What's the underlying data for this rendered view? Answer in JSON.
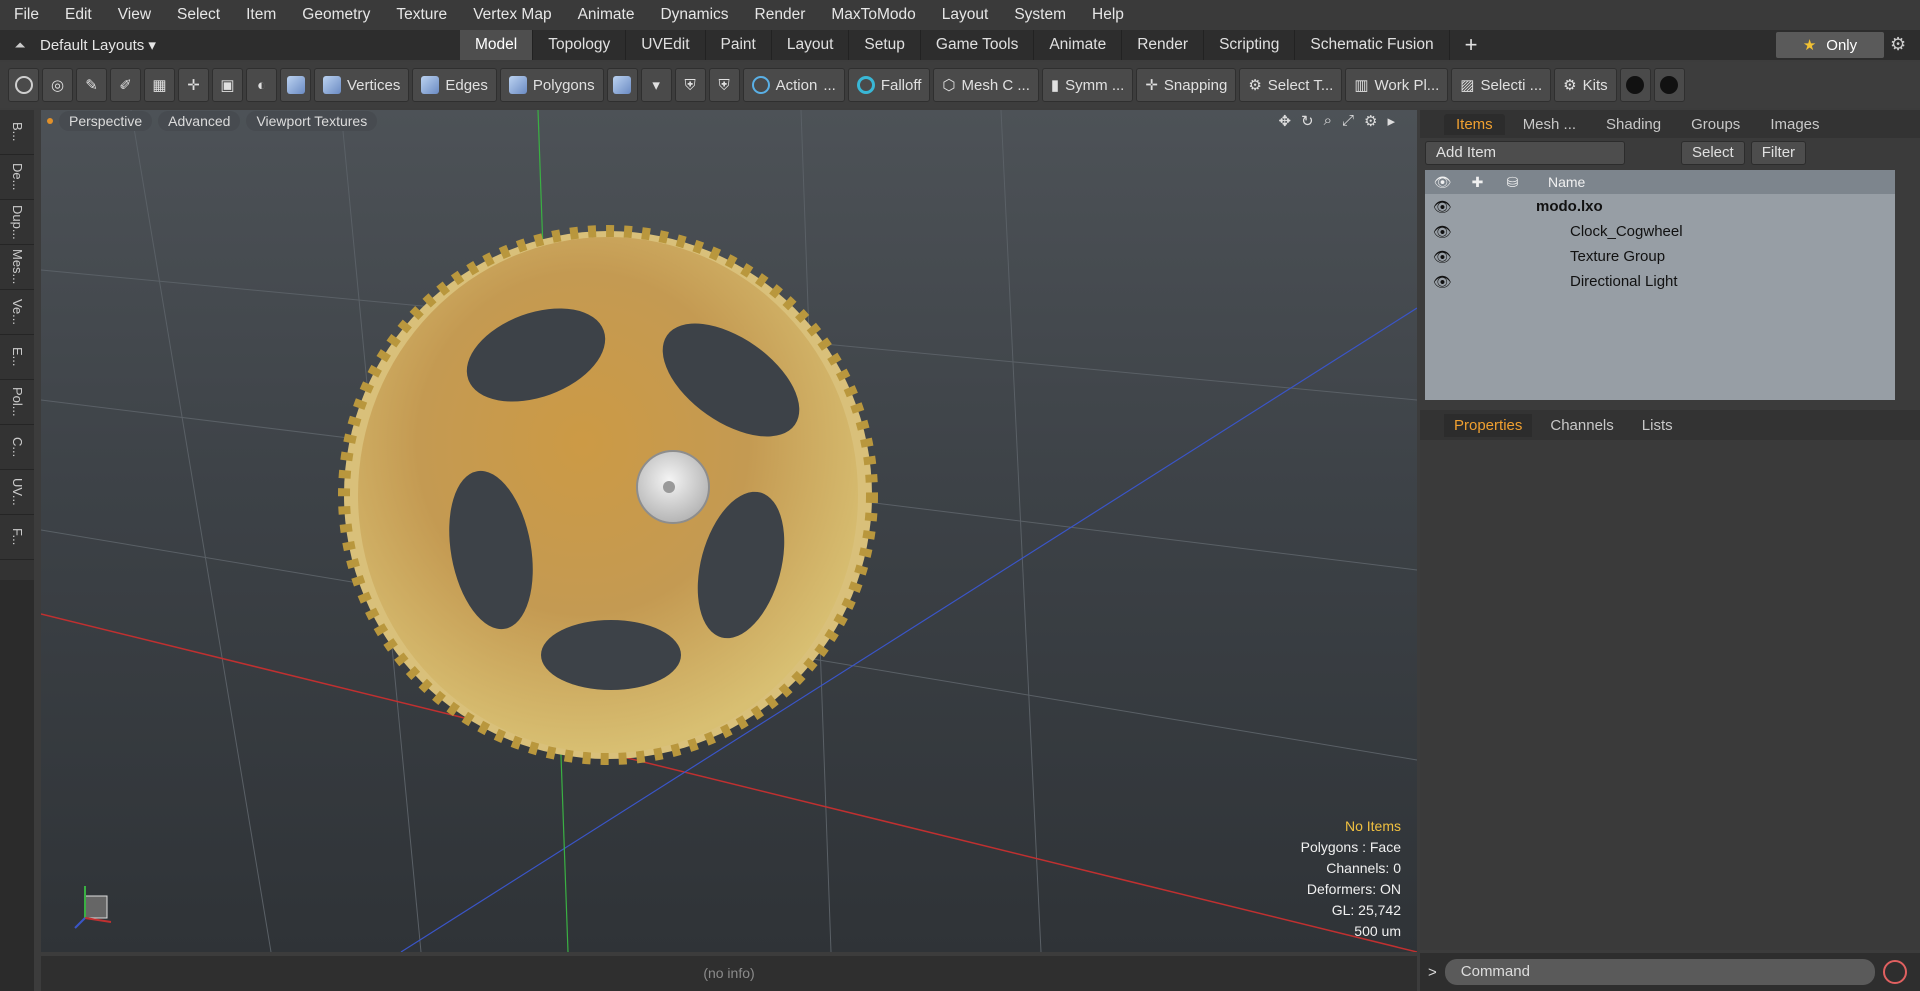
{
  "menu": [
    "File",
    "Edit",
    "View",
    "Select",
    "Item",
    "Geometry",
    "Texture",
    "Vertex Map",
    "Animate",
    "Dynamics",
    "Render",
    "MaxToModo",
    "Layout",
    "System",
    "Help"
  ],
  "layout": {
    "name": "Default Layouts ▾",
    "tabs": [
      "Model",
      "Topology",
      "UVEdit",
      "Paint",
      "Layout",
      "Setup",
      "Game Tools",
      "Animate",
      "Render",
      "Scripting",
      "Schematic Fusion"
    ],
    "active": "Model",
    "only": "Only"
  },
  "toolbar": {
    "vertices": "Vertices",
    "edges": "Edges",
    "polygons": "Polygons",
    "action": "Action",
    "falloff": "Falloff",
    "mesh": "Mesh C ...",
    "symm": "Symm ...",
    "snapping": "Snapping",
    "select_t": "Select T...",
    "workpl": "Work Pl...",
    "selecti": "Selecti ...",
    "kits": "Kits"
  },
  "lefttabs": [
    "B...",
    "De...",
    "Dup...",
    "Mes...",
    "Ve...",
    "E...",
    "Pol...",
    "C...",
    "UV...",
    "F..."
  ],
  "viewport": {
    "perspective": "Perspective",
    "advanced": "Advanced",
    "textures": "Viewport Textures"
  },
  "stats": {
    "items": "No Items",
    "polygons": "Polygons : Face",
    "channels": "Channels: 0",
    "deformers": "Deformers: ON",
    "gl": "GL: 25,742",
    "scale": "500 um"
  },
  "status": "(no info)",
  "items_panel": {
    "tabs": [
      "Items",
      "Mesh ...",
      "Shading",
      "Groups",
      "Images"
    ],
    "add_item": "Add Item",
    "select": "Select",
    "filter": "Filter",
    "name_header": "Name",
    "rows": [
      "modo.lxo",
      "Clock_Cogwheel",
      "Texture Group",
      "Directional Light"
    ]
  },
  "props": {
    "tabs": [
      "Properties",
      "Channels",
      "Lists"
    ]
  },
  "command": "Command"
}
